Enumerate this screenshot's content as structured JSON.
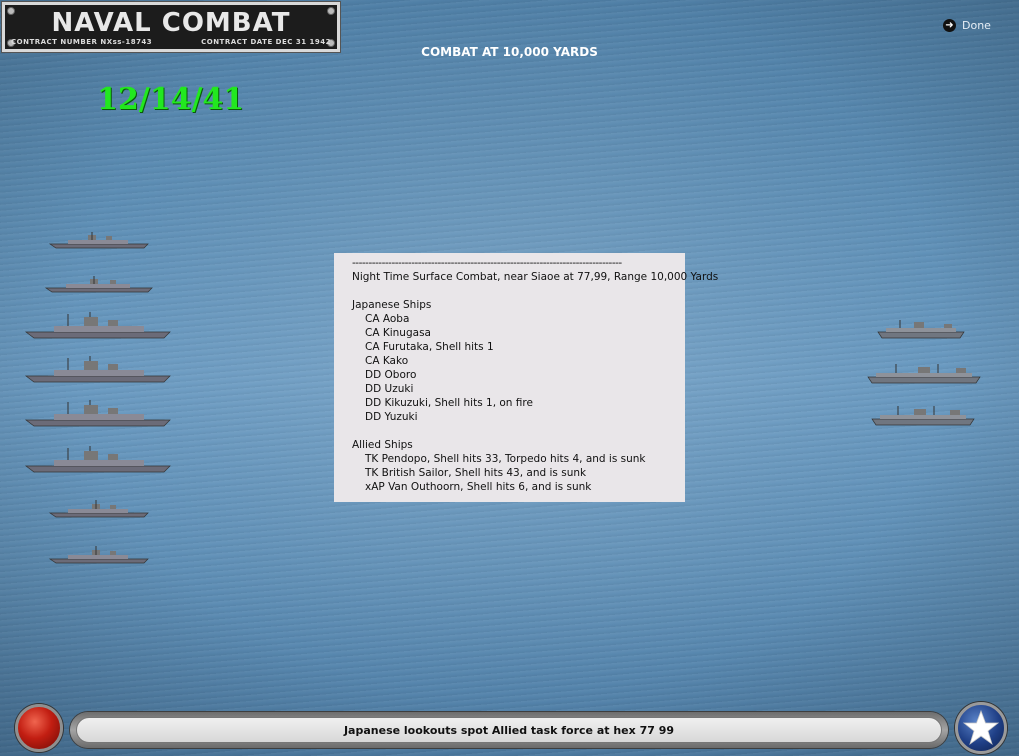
{
  "plaque": {
    "title": "NAVAL COMBAT",
    "contract_number": "CONTRACT NUMBER   NXss-18743",
    "contract_date": "CONTRACT DATE  DEC 31 1942"
  },
  "header": {
    "done_label": "Done",
    "combat_title": "COMBAT AT 10,000 YARDS",
    "date": "12/14/41"
  },
  "report": {
    "separator": "----------------------------------------------------------------------------------",
    "heading": "Night Time Surface Combat, near Siaoe at 77,99, Range 10,000 Yards",
    "japanese_label": "Japanese Ships",
    "japanese": [
      "CA Aoba",
      "CA Kinugasa",
      "CA Furutaka, Shell hits 1",
      "CA Kako",
      "DD Oboro",
      "DD Uzuki",
      "DD Kikuzuki, Shell hits 1,  on fire",
      "DD Yuzuki"
    ],
    "allied_label": "Allied Ships",
    "allied": [
      "TK Pendopo, Shell hits 33, Torpedo hits 4, and is sunk",
      "TK British Sailor, Shell hits 43, and is sunk",
      "xAP Van Outhoorn, Shell hits 6, and is sunk"
    ]
  },
  "status_bar": {
    "message": "Japanese lookouts spot Allied task force at hex 77 99"
  },
  "colors": {
    "date_green": "#22e81f",
    "report_bg": "#e9e6e9",
    "sea": "#5c8db4"
  },
  "icons": {
    "done": "arrow-right-circle-icon",
    "left_button": "red-ball-button",
    "right_button": "us-star-roundel-icon"
  }
}
